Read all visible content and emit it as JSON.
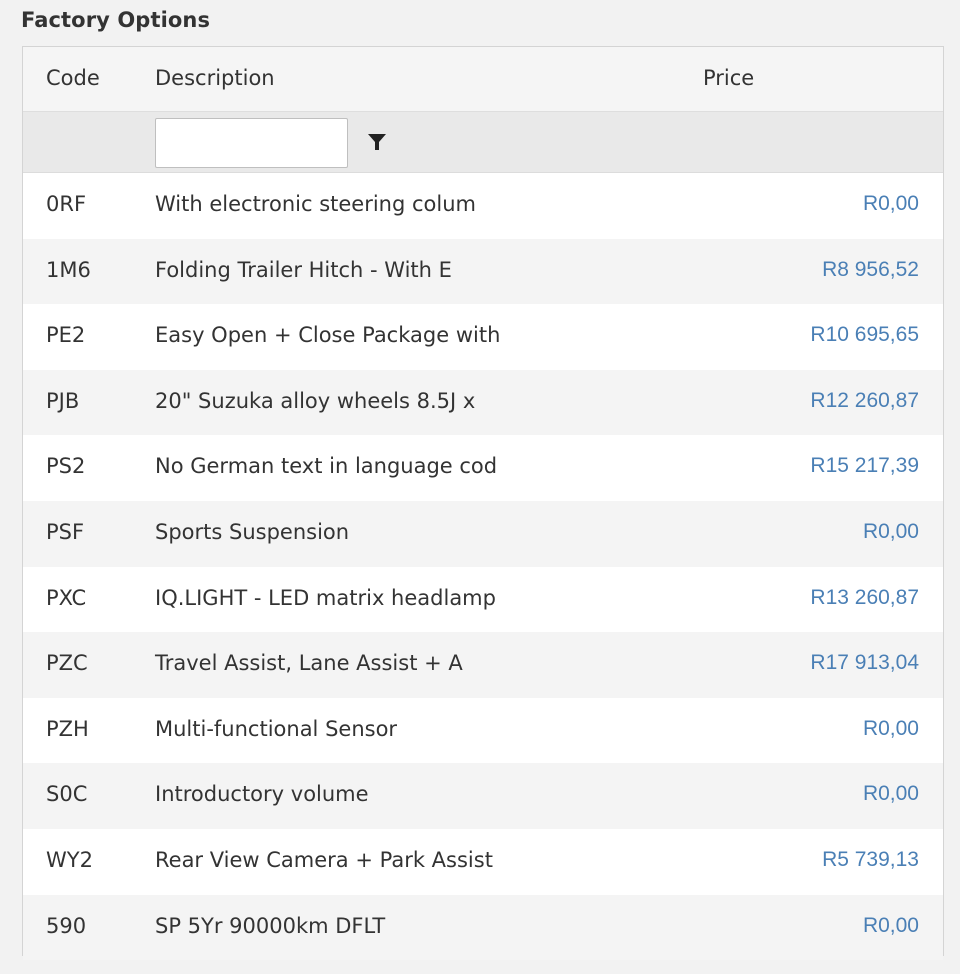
{
  "section": {
    "title": "Factory Options"
  },
  "grid": {
    "columns": {
      "code": "Code",
      "description": "Description",
      "price": "Price"
    },
    "filter": {
      "value": "",
      "icon": "filter-icon"
    },
    "rows": [
      {
        "code": "0RF",
        "description": "With electronic steering colum",
        "price": "R0,00"
      },
      {
        "code": "1M6",
        "description": "Folding Trailer Hitch - With E",
        "price": "R8 956,52"
      },
      {
        "code": "PE2",
        "description": "Easy Open + Close Package with",
        "price": "R10 695,65"
      },
      {
        "code": "PJB",
        "description": "20\" Suzuka alloy wheels 8.5J x",
        "price": "R12 260,87"
      },
      {
        "code": "PS2",
        "description": "No German text in language cod",
        "price": "R15 217,39"
      },
      {
        "code": "PSF",
        "description": "Sports Suspension",
        "price": "R0,00"
      },
      {
        "code": "PXC",
        "description": "IQ.LIGHT - LED matrix headlamp",
        "price": "R13 260,87"
      },
      {
        "code": "PZC",
        "description": "Travel Assist, Lane Assist + A",
        "price": "R17 913,04"
      },
      {
        "code": "PZH",
        "description": "Multi-functional Sensor",
        "price": "R0,00"
      },
      {
        "code": "S0C",
        "description": "Introductory volume",
        "price": "R0,00"
      },
      {
        "code": "WY2",
        "description": "Rear View Camera + Park Assist",
        "price": "R5 739,13"
      },
      {
        "code": "590",
        "description": "SP 5Yr 90000km DFLT",
        "price": "R0,00"
      }
    ]
  },
  "colors": {
    "price_link": "#4a7fb5",
    "header_bg": "#f5f5f5",
    "filter_bg": "#e9e9e9",
    "alt_row_bg": "#f4f4f4"
  }
}
